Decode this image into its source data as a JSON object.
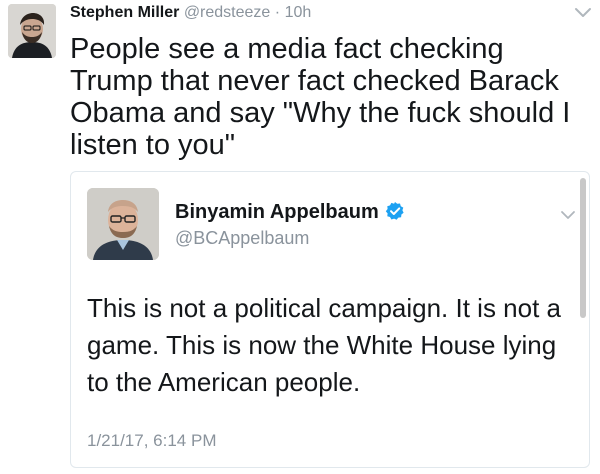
{
  "tweet": {
    "author_name": "Stephen Miller",
    "author_handle": "@redsteeze",
    "separator": "·",
    "time": "10h",
    "text": "People see a media fact checking Trump that never fact checked Barack Obama and say \"Why the fuck should I listen to you\"",
    "avatar_icon": "person-avatar",
    "menu_icon": "chevron-down-icon"
  },
  "quoted_tweet": {
    "author_name": "Binyamin Appelbaum",
    "author_handle": "@BCAppelbaum",
    "verified_icon": "verified-badge-icon",
    "text": "This is not a political campaign. It is not a game. This is now the White House lying to the American people.",
    "timestamp": "1/21/17, 6:14 PM",
    "menu_icon": "chevron-down-icon"
  },
  "colors": {
    "text": "#14171a",
    "muted": "#8a939c",
    "border": "#e1e8ed",
    "verified_blue": "#1da1f2"
  }
}
